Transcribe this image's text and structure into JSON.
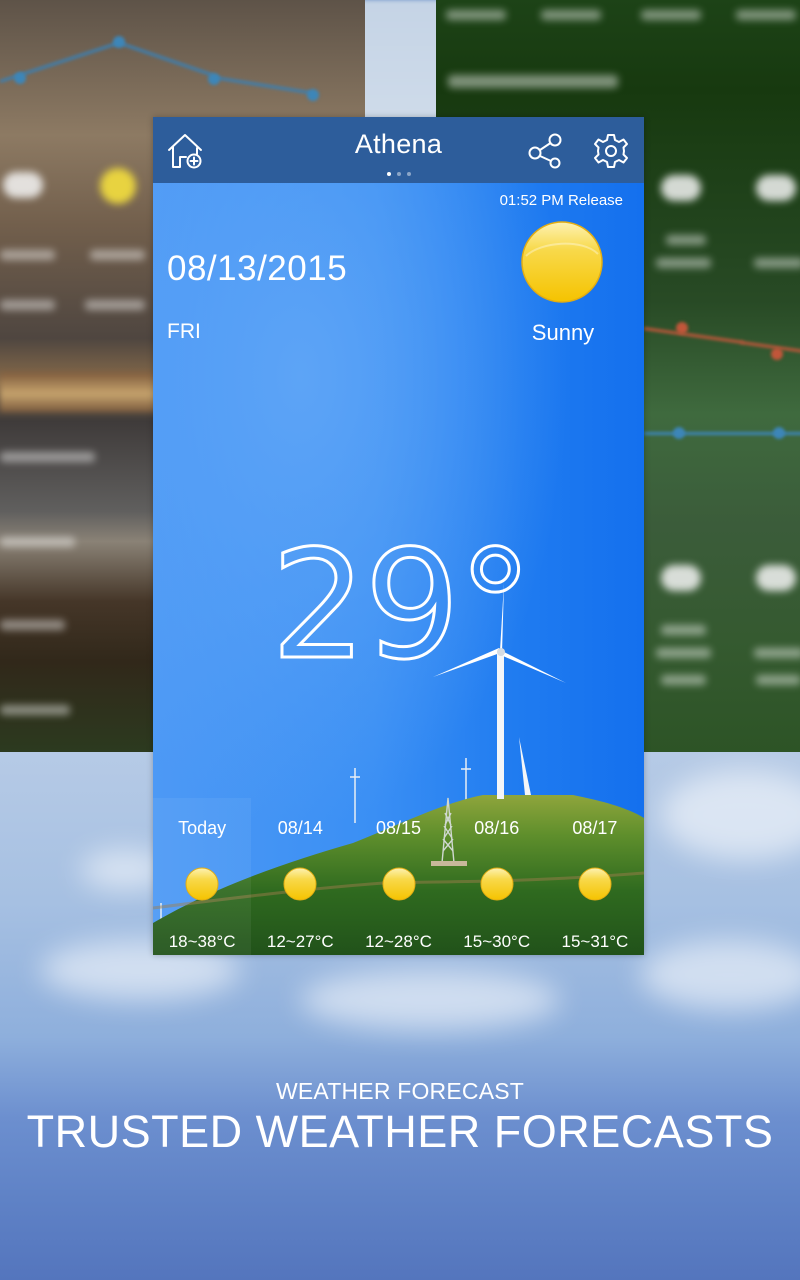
{
  "header": {
    "city": "Athena",
    "pager": {
      "pages": 3,
      "active_index": 0
    },
    "icons": {
      "left": "home-add-icon",
      "share": "share-icon",
      "settings": "gear-icon"
    }
  },
  "current": {
    "release_time": "01:52 PM Release",
    "date": "08/13/2015",
    "weekday": "FRI",
    "condition": "Sunny",
    "condition_icon": "sun-icon",
    "temperature": "29°"
  },
  "forecast": [
    {
      "day": "Today",
      "icon": "sun-icon",
      "range": "18~38°C"
    },
    {
      "day": "08/14",
      "icon": "sun-icon",
      "range": "12~27°C"
    },
    {
      "day": "08/15",
      "icon": "sun-icon",
      "range": "12~28°C"
    },
    {
      "day": "08/16",
      "icon": "sun-icon",
      "range": "15~30°C"
    },
    {
      "day": "08/17",
      "icon": "sun-icon",
      "range": "15~31°C"
    }
  ],
  "caption": {
    "subtitle": "WEATHER FORECAST",
    "title": "TRUSTED WEATHER FORECASTS"
  },
  "colors": {
    "topbar": "#2d5d9b",
    "sky": "#3a8ff4",
    "sun": "#f7cf1b",
    "text": "#ffffff"
  }
}
